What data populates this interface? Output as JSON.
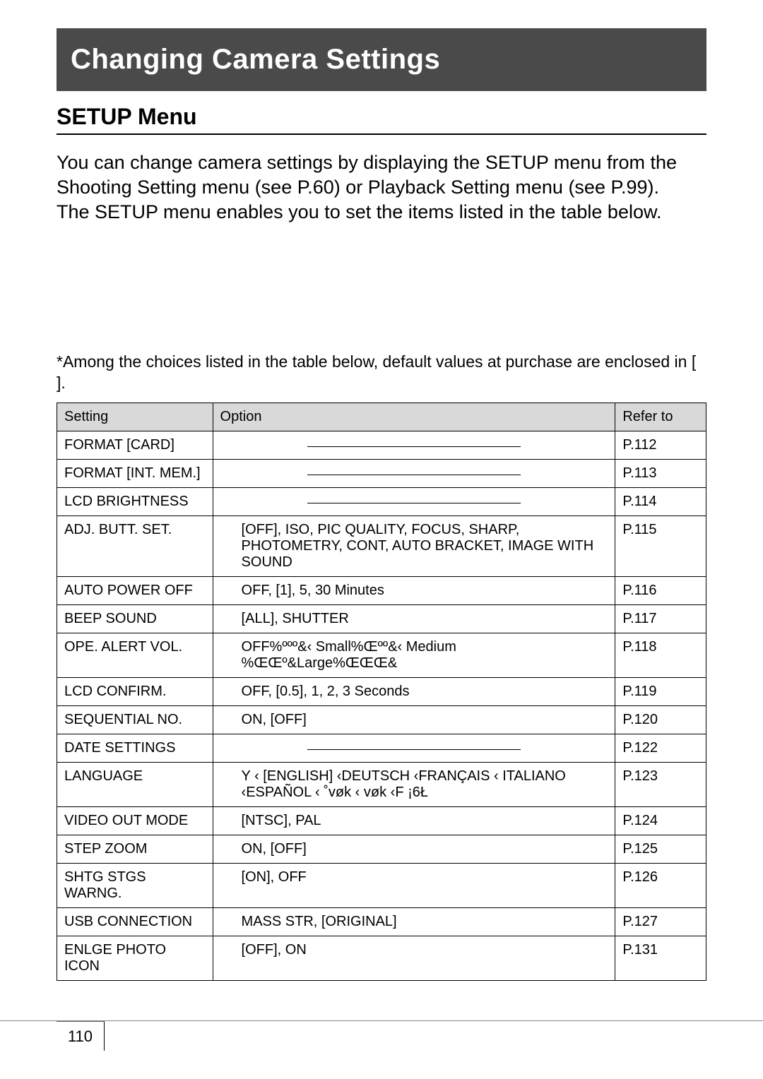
{
  "header": {
    "title": "Changing Camera Settings"
  },
  "subtitle": "SETUP Menu",
  "intro_text": "You can change camera settings by displaying the SETUP menu from the Shooting Setting menu (see P.60) or Playback Setting menu (see P.99).\nThe SETUP menu enables you to set the items listed in the table below.",
  "footnote": "*Among the choices listed in the table below, default values at purchase are enclosed in [ ].",
  "table": {
    "headers": {
      "setting": "Setting",
      "option": "Option",
      "refer": "Refer to"
    },
    "rows": [
      {
        "setting": "FORMAT [CARD]",
        "option": "",
        "option_is_dash": true,
        "refer": "P.112"
      },
      {
        "setting": "FORMAT [INT. MEM.]",
        "option": "",
        "option_is_dash": true,
        "refer": "P.113"
      },
      {
        "setting": "LCD BRIGHTNESS",
        "option": "",
        "option_is_dash": true,
        "refer": "P.114"
      },
      {
        "setting": "ADJ. BUTT. SET.",
        "option": "[OFF], ISO, PIC QUALITY, FOCUS, SHARP, PHOTOMETRY, CONT, AUTO BRACKET, IMAGE WITH SOUND",
        "option_is_dash": false,
        "refer": "P.115"
      },
      {
        "setting": "AUTO POWER OFF",
        "option": "OFF, [1], 5, 30 Minutes",
        "option_is_dash": false,
        "refer": "P.116"
      },
      {
        "setting": "BEEP SOUND",
        "option": "[ALL], SHUTTER",
        "option_is_dash": false,
        "refer": "P.117"
      },
      {
        "setting": "OPE. ALERT VOL.",
        "option": "OFF%ººº&‹  Small%Œºº&‹ Medium %ŒŒº&Large%ŒŒŒ&",
        "option_is_dash": false,
        "refer": "P.118"
      },
      {
        "setting": "LCD CONFIRM.",
        "option": "OFF, [0.5], 1, 2, 3 Seconds",
        "option_is_dash": false,
        "refer": "P.119"
      },
      {
        "setting": "SEQUENTIAL NO.",
        "option": "ON, [OFF]",
        "option_is_dash": false,
        "refer": "P.120"
      },
      {
        "setting": "DATE SETTINGS",
        "option": "",
        "option_is_dash": true,
        "refer": "P.122"
      },
      {
        "setting": "LANGUAGE",
        "option": "Y ‹  [ENGLISH] ‹DEUTSCH ‹FRANÇAIS ‹ ITALIANO ‹ESPAÑOL ‹ ˚vøk ‹  vøk ‹F ¡6Ł",
        "option_is_dash": false,
        "refer": "P.123"
      },
      {
        "setting": "VIDEO OUT MODE",
        "option": "[NTSC], PAL",
        "option_is_dash": false,
        "refer": "P.124"
      },
      {
        "setting": "STEP ZOOM",
        "option": "ON, [OFF]",
        "option_is_dash": false,
        "refer": "P.125"
      },
      {
        "setting": "SHTG STGS WARNG.",
        "option": "[ON], OFF",
        "option_is_dash": false,
        "refer": "P.126"
      },
      {
        "setting": "USB CONNECTION",
        "option": "MASS STR, [ORIGINAL]",
        "option_is_dash": false,
        "refer": "P.127"
      },
      {
        "setting": "ENLGE PHOTO ICON",
        "option": "[OFF], ON",
        "option_is_dash": false,
        "refer": "P.131"
      }
    ]
  },
  "page_number": "110"
}
